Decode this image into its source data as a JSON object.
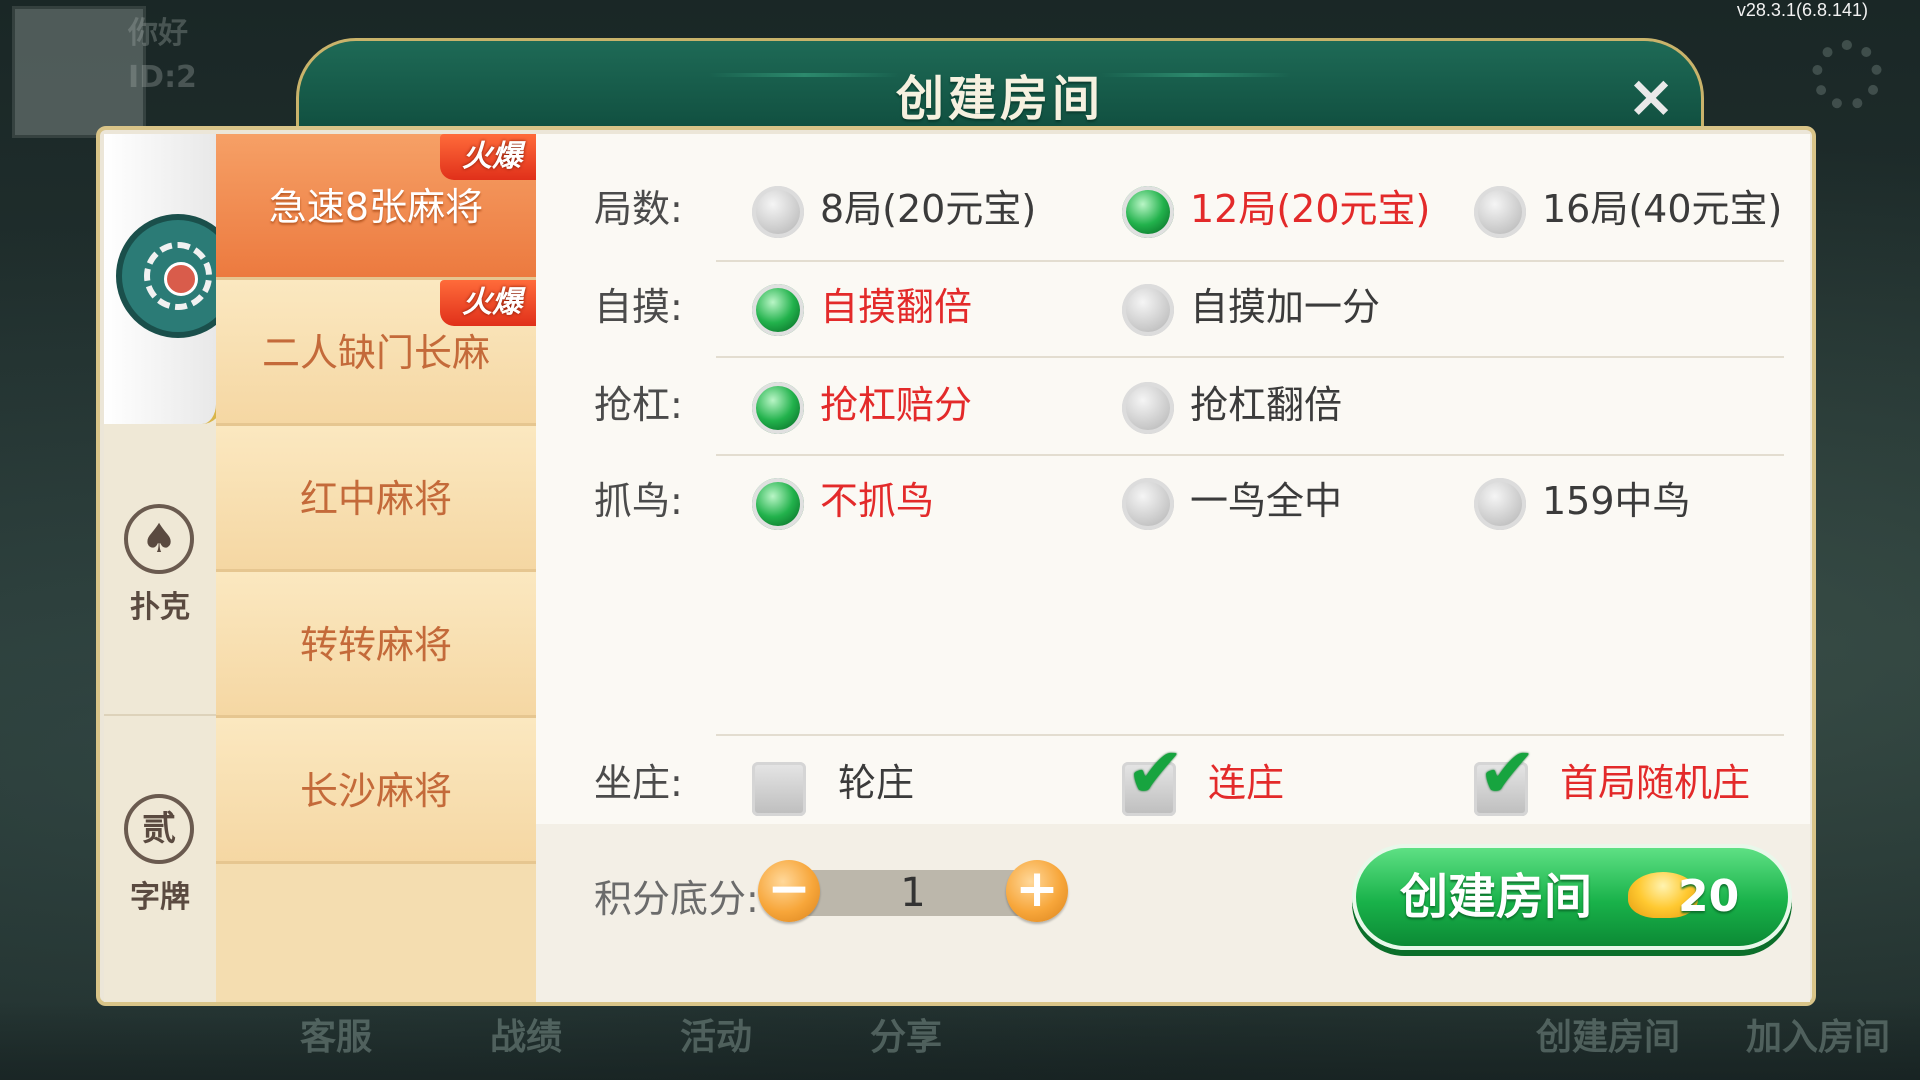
{
  "version": "v28.3.1(6.8.141)",
  "background": {
    "greeting": "你好",
    "id_prefix": "ID:2",
    "bottom_items": [
      "客服",
      "战绩",
      "活动",
      "分享",
      "创建房间",
      "加入房间"
    ]
  },
  "dialog": {
    "title": "创建房间",
    "close_label": "×"
  },
  "categories": [
    {
      "label": "",
      "icon": "mahjong-tile-icon",
      "active": true
    },
    {
      "label": "扑克",
      "icon": "spade-icon",
      "active": false
    },
    {
      "label": "字牌",
      "icon": "zipai-icon",
      "icon_char": "贰",
      "active": false
    }
  ],
  "games": [
    {
      "label": "急速8张麻将",
      "hot": "火爆",
      "active": true
    },
    {
      "label": "二人缺门长麻",
      "hot": "火爆",
      "active": false
    },
    {
      "label": "红中麻将",
      "hot": "",
      "active": false
    },
    {
      "label": "转转麻将",
      "hot": "",
      "active": false
    },
    {
      "label": "长沙麻将",
      "hot": "",
      "active": false
    }
  ],
  "options": {
    "rounds": {
      "label": "局数:",
      "choices": [
        "8局(20元宝)",
        "12局(20元宝)",
        "16局(40元宝)"
      ],
      "selected": 1
    },
    "zimo": {
      "label": "自摸:",
      "choices": [
        "自摸翻倍",
        "自摸加一分"
      ],
      "selected": 0
    },
    "qianggang": {
      "label": "抢杠:",
      "choices": [
        "抢杠赔分",
        "抢杠翻倍"
      ],
      "selected": 0
    },
    "zhuaniao": {
      "label": "抓鸟:",
      "choices": [
        "不抓鸟",
        "一鸟全中",
        "159中鸟"
      ],
      "selected": 0
    },
    "zuozhuang": {
      "label": "坐庄:",
      "choices": [
        "轮庄",
        "连庄",
        "首局随机庄"
      ],
      "checked": [
        false,
        true,
        true
      ]
    }
  },
  "score": {
    "label": "积分底分:",
    "value": "1",
    "minus": "−",
    "plus": "+"
  },
  "create_button": {
    "label": "创建房间",
    "cost": "20"
  },
  "colors": {
    "header_green": "#0f4c3d",
    "selected_red": "#e32a2a",
    "radio_green": "#22b24c",
    "tab_orange": "#ec7a3f",
    "button_green": "#19b24a"
  }
}
